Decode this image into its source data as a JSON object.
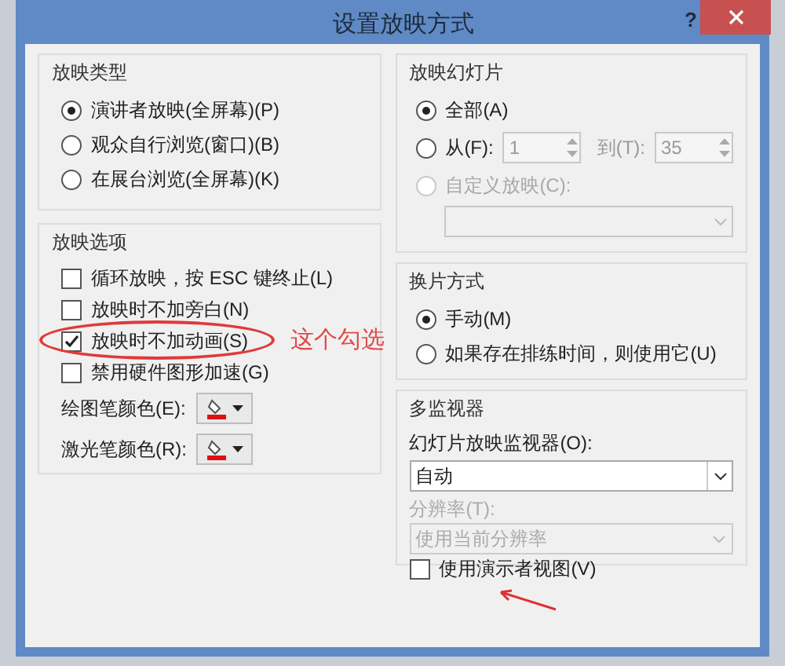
{
  "window": {
    "title": "设置放映方式",
    "help": "?"
  },
  "show_type": {
    "title": "放映类型",
    "options": [
      {
        "label": "演讲者放映(全屏幕)(P)",
        "selected": true
      },
      {
        "label": "观众自行浏览(窗口)(B)",
        "selected": false
      },
      {
        "label": "在展台浏览(全屏幕)(K)",
        "selected": false
      }
    ]
  },
  "show_options": {
    "title": "放映选项",
    "checkboxes": [
      {
        "label": "循环放映，按 ESC 键终止(L)",
        "checked": false,
        "circled": false
      },
      {
        "label": "放映时不加旁白(N)",
        "checked": false,
        "circled": false
      },
      {
        "label": "放映时不加动画(S)",
        "checked": true,
        "circled": true
      },
      {
        "label": "禁用硬件图形加速(G)",
        "checked": false,
        "circled": false
      }
    ],
    "pens": [
      {
        "label": "绘图笔颜色(E):"
      },
      {
        "label": "激光笔颜色(R):"
      }
    ]
  },
  "annotation": {
    "text": "这个勾选"
  },
  "slides": {
    "title": "放映幻灯片",
    "options": [
      {
        "kind": "all",
        "label": "全部(A)",
        "selected": true,
        "disabled": false
      },
      {
        "kind": "range",
        "label": "从(F):",
        "selected": false,
        "disabled": false
      },
      {
        "kind": "custom",
        "label": "自定义放映(C):",
        "selected": false,
        "disabled": true
      }
    ],
    "from": "1",
    "to_label": "到(T):",
    "to": "35"
  },
  "advance": {
    "title": "换片方式",
    "options": [
      {
        "label": "手动(M)",
        "selected": true
      },
      {
        "label": "如果存在排练时间，则使用它(U)",
        "selected": false
      }
    ]
  },
  "monitors": {
    "title": "多监视器",
    "monitor_label": "幻灯片放映监视器(O):",
    "monitor_value": "自动",
    "resolution_label": "分辨率(T):",
    "resolution_value": "使用当前分辨率",
    "resolution_disabled": true,
    "presenter_view": {
      "label": "使用演示者视图(V)",
      "checked": false
    }
  }
}
